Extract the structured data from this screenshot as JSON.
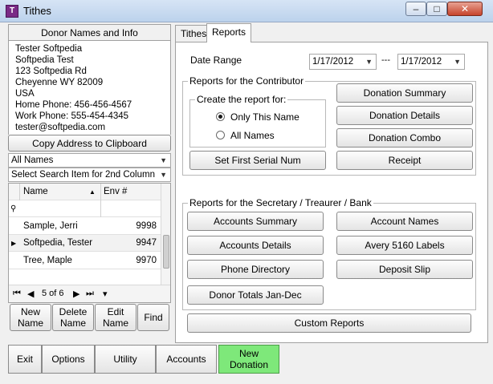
{
  "window": {
    "title": "Tithes",
    "icon_text": "T"
  },
  "donor_panel": {
    "header": "Donor Names and Info",
    "info_lines": [
      "Tester Softpedia",
      "Softpedia Test",
      "123 Softpedia Rd",
      "Cheyenne WY 82009",
      "USA",
      "Home Phone: 456-456-4567",
      "Work Phone: 555-454-4345",
      "tester@softpedia.com"
    ],
    "copy_button": "Copy Address to Clipboard",
    "filter_combo": "All Names",
    "search_combo": "Select Search Item for 2nd Column",
    "grid": {
      "columns": [
        "Name",
        "Env #"
      ],
      "rows": [
        {
          "name": "Sample, Jerri",
          "env": "9998"
        },
        {
          "name": "Softpedia, Tester",
          "env": "9947"
        },
        {
          "name": "Tree, Maple",
          "env": "9970"
        }
      ],
      "pager": "5 of 6"
    },
    "buttons": [
      "New\nName",
      "Delete\nName",
      "Edit\nName",
      "Find"
    ]
  },
  "tabs": [
    "Tithes",
    "Reports"
  ],
  "reports": {
    "date_range_label": "Date Range",
    "date_from": "1/17/2012",
    "date_sep": "---",
    "date_to": "1/17/2012",
    "contributor_group": "Reports for the Contributor",
    "create_for_group": "Create the report for:",
    "radio_only_this": "Only This Name",
    "radio_all_names": "All Names",
    "set_serial": "Set First Serial Num",
    "contrib_buttons": [
      "Donation Summary",
      "Donation Details",
      "Donation Combo",
      "Receipt"
    ],
    "secretary_group": "Reports for the Secretary / Treaurer / Bank",
    "sec_left": [
      "Accounts Summary",
      "Accounts Details",
      "Phone Directory",
      "Donor Totals Jan-Dec"
    ],
    "sec_right": [
      "Account Names",
      "Avery 5160 Labels",
      "Deposit Slip"
    ],
    "custom_reports": "Custom Reports"
  },
  "bottom_buttons": [
    "Exit",
    "Options",
    "Utility",
    "Accounts",
    "New\nDonation"
  ],
  "colors": {
    "new_donation_bg": "#7ee87a",
    "title_icon": "#7a2b86"
  }
}
